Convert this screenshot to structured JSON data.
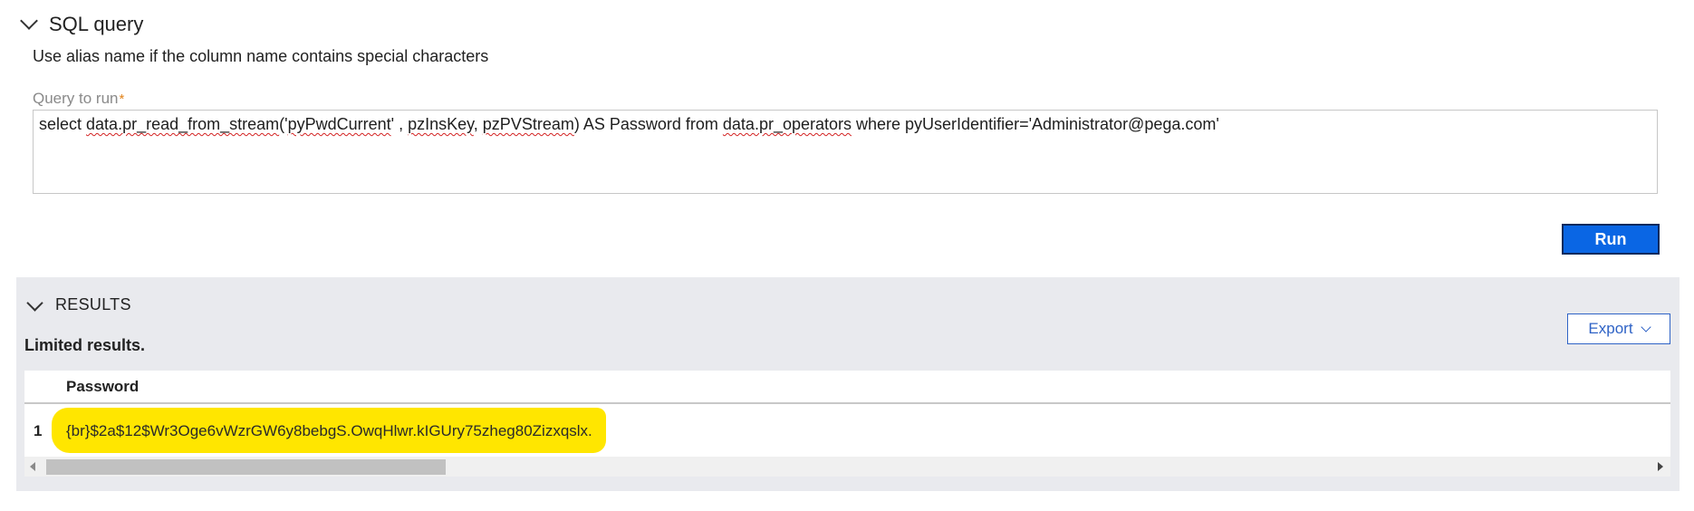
{
  "sql_section": {
    "title": "SQL query",
    "hint": "Use alias name if the column name contains special characters",
    "query_label": "Query to run",
    "required_marker": "*",
    "query_parts": [
      "select ",
      "data.pr_read_from_stream",
      "('",
      "pyPwdCurrent",
      "' , ",
      "pzInsKey",
      ", ",
      "pzPVStream",
      ") AS Password from ",
      "data.pr_operators",
      " where pyUserIdentifier='Administrator@pega.com'"
    ],
    "run_label": "Run"
  },
  "results": {
    "title": "RESULTS",
    "export_label": "Export",
    "limited_text": "Limited results.",
    "columns": [
      "Password"
    ],
    "rows": [
      {
        "num": "1",
        "password": "{br}$2a$12$Wr3Oge6vWzrGW6y8bebgS.OwqHlwr.kIGUry75zheg80Zizxqslx."
      }
    ]
  },
  "colors": {
    "accent": "#0a66e4",
    "highlight": "#ffe600",
    "required": "#e2831a",
    "panel_bg": "#e9eaee"
  },
  "icons": [
    "chevron-down-icon",
    "scroll-left-arrow-icon",
    "scroll-right-arrow-icon"
  ]
}
